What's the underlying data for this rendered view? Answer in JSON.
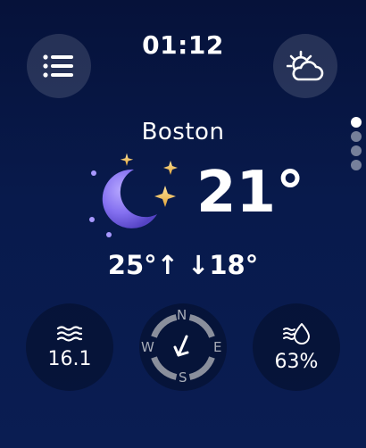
{
  "time": "01:12",
  "city": "Boston",
  "current": {
    "temperature": "21°",
    "condition_icon": "clear-night-moon-stars-icon"
  },
  "forecast": {
    "high_low": "25°↑ ↓18°"
  },
  "stats": {
    "wind_value": "16.1",
    "humidity_value": "63%"
  },
  "compass": {
    "n": "N",
    "e": "E",
    "s": "S",
    "w": "W"
  },
  "icons": {
    "menu": "list-menu-icon",
    "weather": "partly-cloudy-night-icon",
    "wind": "wind-waves-icon",
    "humidity": "humidity-drop-icon"
  },
  "colors": {
    "background": "#081a4c",
    "moon": "#8b7cf6",
    "stars": "#f6c35a"
  }
}
